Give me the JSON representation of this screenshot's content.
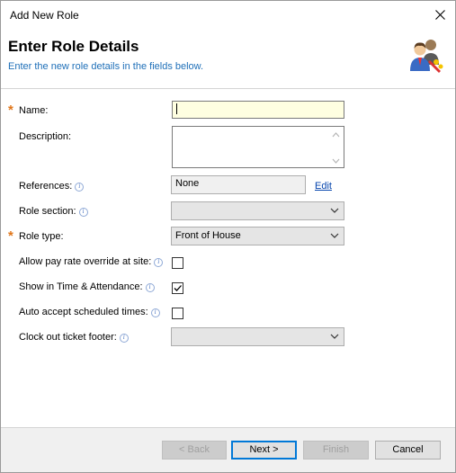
{
  "window": {
    "title": "Add New Role"
  },
  "header": {
    "title": "Enter Role Details",
    "subtitle": "Enter the new role details in the fields below.",
    "icon": "users-roles-icon"
  },
  "form": {
    "name": {
      "label": "Name:",
      "value": "",
      "required": true
    },
    "description": {
      "label": "Description:",
      "value": ""
    },
    "references": {
      "label": "References:",
      "value": "None",
      "edit_label": "Edit"
    },
    "role_section": {
      "label": "Role section:",
      "value": ""
    },
    "role_type": {
      "label": "Role type:",
      "value": "Front of House",
      "required": true
    },
    "allow_pay_rate": {
      "label": "Allow pay rate override at site:",
      "checked": false
    },
    "show_time_attendance": {
      "label": "Show in Time & Attendance:",
      "checked": true
    },
    "auto_accept": {
      "label": "Auto accept scheduled times:",
      "checked": false
    },
    "clock_out_footer": {
      "label": "Clock out ticket footer:",
      "value": ""
    }
  },
  "buttons": {
    "back": "< Back",
    "next": "Next >",
    "finish": "Finish",
    "cancel": "Cancel"
  },
  "colors": {
    "accent": "#1e6fb8",
    "required": "#e0761a",
    "input_highlight": "#ffffe1"
  }
}
